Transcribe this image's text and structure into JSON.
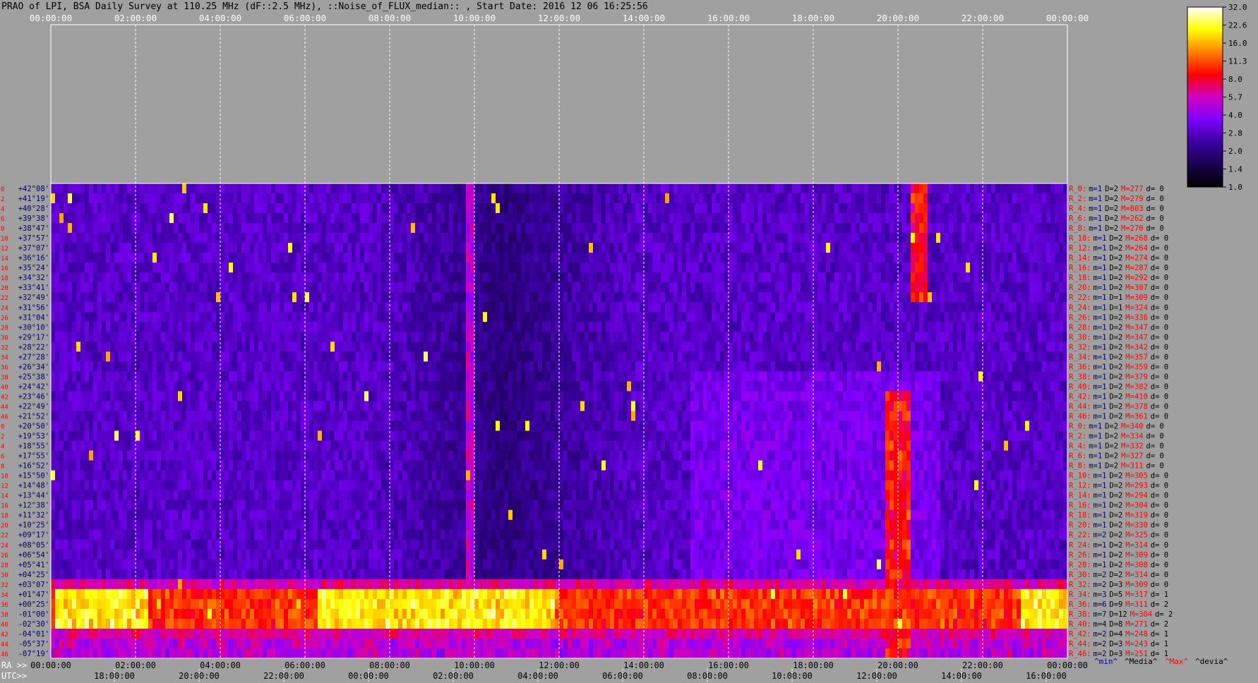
{
  "chart_data": {
    "type": "heatmap",
    "title": "PRAO of LPI, BSA Daily Survey at 110.25 MHz (dF::2.5 MHz), ::Noise_of_FLUX_median:: , Start Date: 2016 12 06 16:25:56",
    "x_top_ticks": [
      "00:00:00",
      "02:00:00",
      "04:00:00",
      "06:00:00",
      "08:00:00",
      "10:00:00",
      "12:00:00",
      "14:00:00",
      "16:00:00",
      "18:00:00",
      "20:00:00",
      "22:00:00",
      "00:00:00"
    ],
    "x_bottom_ra_prefix": "RA >>",
    "x_bottom_ra_ticks": [
      "00:00:00",
      "02:00:00",
      "04:00:00",
      "06:00:00",
      "08:00:00",
      "10:00:00",
      "12:00:00",
      "14:00:00",
      "16:00:00",
      "18:00:00",
      "20:00:00",
      "22:00:00",
      "00:00:00"
    ],
    "x_bottom_utc_prefix": "UTC>>",
    "x_bottom_utc_ticks": [
      "18:00:00",
      "20:00:00",
      "22:00:00",
      "00:00:00",
      "02:00:00",
      "04:00:00",
      "06:00:00",
      "08:00:00",
      "10:00:00",
      "12:00:00",
      "14:00:00",
      "16:00:00"
    ],
    "row_index_labels": [
      "0",
      "2",
      "4",
      "6",
      "8",
      "10",
      "12",
      "14",
      "16",
      "18",
      "20",
      "22",
      "24",
      "26",
      "28",
      "30",
      "32",
      "34",
      "36",
      "38",
      "40",
      "42",
      "44",
      "46",
      "0",
      "2",
      "4",
      "6",
      "8",
      "10",
      "12",
      "14",
      "16",
      "18",
      "20",
      "22",
      "24",
      "26",
      "28",
      "30",
      "32",
      "34",
      "36",
      "38",
      "40",
      "42",
      "44",
      "46"
    ],
    "declinations": [
      "+42°08'",
      "+41°19'",
      "+40°28'",
      "+39°38'",
      "+38°47'",
      "+37°57'",
      "+37°07'",
      "+36°16'",
      "+35°24'",
      "+34°32'",
      "+33°41'",
      "+32°49'",
      "+31°56'",
      "+31°04'",
      "+30°10'",
      "+29°17'",
      "+28°22'",
      "+27°28'",
      "+26°34'",
      "+25°38'",
      "+24°42'",
      "+23°46'",
      "+22°49'",
      "+21°52'",
      "+20°50'",
      "+19°53'",
      "+18°55'",
      "+17°55'",
      "+16°52'",
      "+15°50'",
      "+14°48'",
      "+13°44'",
      "+12°38'",
      "+11°32'",
      "+10°25'",
      "+09°17'",
      "+08°05'",
      "+06°54'",
      "+05°41'",
      "+04°25'",
      "+03°07'",
      "+01°47'",
      "+00°25'",
      "-01°00'",
      "-02°30'",
      "-04°01'",
      "-05°37'",
      "-07°19'"
    ],
    "right_stats": [
      {
        "r": "R_0:",
        "m": "m=1",
        "d": "D=2",
        "mx": "M=277",
        "dev": "d= 0"
      },
      {
        "r": "R_2:",
        "m": "m=1",
        "d": "D=2",
        "mx": "M=279",
        "dev": "d= 0"
      },
      {
        "r": "R_4:",
        "m": "m=1",
        "d": "D=2",
        "mx": "M=803",
        "dev": "d= 0"
      },
      {
        "r": "R_6:",
        "m": "m=1",
        "d": "D=2",
        "mx": "M=262",
        "dev": "d= 0"
      },
      {
        "r": "R_8:",
        "m": "m=1",
        "d": "D=2",
        "mx": "M=270",
        "dev": "d= 0"
      },
      {
        "r": "R_10:",
        "m": "m=1",
        "d": "D=2",
        "mx": "M=268",
        "dev": "d= 0"
      },
      {
        "r": "R_12:",
        "m": "m=1",
        "d": "D=2",
        "mx": "M=264",
        "dev": "d= 0"
      },
      {
        "r": "R_14:",
        "m": "m=1",
        "d": "D=2",
        "mx": "M=274",
        "dev": "d= 0"
      },
      {
        "r": "R_16:",
        "m": "m=1",
        "d": "D=2",
        "mx": "M=287",
        "dev": "d= 0"
      },
      {
        "r": "R_18:",
        "m": "m=1",
        "d": "D=2",
        "mx": "M=292",
        "dev": "d= 0"
      },
      {
        "r": "R_20:",
        "m": "m=1",
        "d": "D=2",
        "mx": "M=307",
        "dev": "d= 0"
      },
      {
        "r": "R_22:",
        "m": "m=1",
        "d": "D=1",
        "mx": "M=309",
        "dev": "d= 0"
      },
      {
        "r": "R_24:",
        "m": "m=1",
        "d": "D=1",
        "mx": "M=324",
        "dev": "d= 0"
      },
      {
        "r": "R_26:",
        "m": "m=1",
        "d": "D=2",
        "mx": "M=336",
        "dev": "d= 0"
      },
      {
        "r": "R_28:",
        "m": "m=1",
        "d": "D=2",
        "mx": "M=347",
        "dev": "d= 0"
      },
      {
        "r": "R_30:",
        "m": "m=1",
        "d": "D=2",
        "mx": "M=347",
        "dev": "d= 0"
      },
      {
        "r": "R_32:",
        "m": "m=1",
        "d": "D=2",
        "mx": "M=342",
        "dev": "d= 0"
      },
      {
        "r": "R_34:",
        "m": "m=1",
        "d": "D=2",
        "mx": "M=357",
        "dev": "d= 0"
      },
      {
        "r": "R_36:",
        "m": "m=1",
        "d": "D=2",
        "mx": "M=359",
        "dev": "d= 0"
      },
      {
        "r": "R_38:",
        "m": "m=1",
        "d": "D=2",
        "mx": "M=379",
        "dev": "d= 0"
      },
      {
        "r": "R_40:",
        "m": "m=1",
        "d": "D=2",
        "mx": "M=382",
        "dev": "d= 0"
      },
      {
        "r": "R_42:",
        "m": "m=1",
        "d": "D=2",
        "mx": "M=410",
        "dev": "d= 0"
      },
      {
        "r": "R_44:",
        "m": "m=1",
        "d": "D=2",
        "mx": "M=378",
        "dev": "d= 0"
      },
      {
        "r": "R_46:",
        "m": "m=1",
        "d": "D=2",
        "mx": "M=361",
        "dev": "d= 0"
      },
      {
        "r": "R_0:",
        "m": "m=1",
        "d": "D=2",
        "mx": "M=340",
        "dev": "d= 0"
      },
      {
        "r": "R_2:",
        "m": "m=1",
        "d": "D=2",
        "mx": "M=334",
        "dev": "d= 0"
      },
      {
        "r": "R_4:",
        "m": "m=1",
        "d": "D=2",
        "mx": "M=332",
        "dev": "d= 0"
      },
      {
        "r": "R_6:",
        "m": "m=1",
        "d": "D=2",
        "mx": "M=327",
        "dev": "d= 0"
      },
      {
        "r": "R_8:",
        "m": "m=1",
        "d": "D=2",
        "mx": "M=311",
        "dev": "d= 0"
      },
      {
        "r": "R_10:",
        "m": "m=1",
        "d": "D=2",
        "mx": "M=305",
        "dev": "d= 0"
      },
      {
        "r": "R_12:",
        "m": "m=1",
        "d": "D=2",
        "mx": "M=293",
        "dev": "d= 0"
      },
      {
        "r": "R_14:",
        "m": "m=1",
        "d": "D=2",
        "mx": "M=294",
        "dev": "d= 0"
      },
      {
        "r": "R_16:",
        "m": "m=1",
        "d": "D=2",
        "mx": "M=304",
        "dev": "d= 0"
      },
      {
        "r": "R_18:",
        "m": "m=1",
        "d": "D=2",
        "mx": "M=319",
        "dev": "d= 0"
      },
      {
        "r": "R_20:",
        "m": "m=1",
        "d": "D=2",
        "mx": "M=330",
        "dev": "d= 0"
      },
      {
        "r": "R_22:",
        "m": "m=2",
        "d": "D=2",
        "mx": "M=325",
        "dev": "d= 0"
      },
      {
        "r": "R_24:",
        "m": "m=1",
        "d": "D=2",
        "mx": "M=314",
        "dev": "d= 0"
      },
      {
        "r": "R_26:",
        "m": "m=1",
        "d": "D=2",
        "mx": "M=309",
        "dev": "d= 0"
      },
      {
        "r": "R_28:",
        "m": "m=1",
        "d": "D=2",
        "mx": "M=308",
        "dev": "d= 0"
      },
      {
        "r": "R_30:",
        "m": "m=2",
        "d": "D=2",
        "mx": "M=314",
        "dev": "d= 0"
      },
      {
        "r": "R_32:",
        "m": "m=2",
        "d": "D=3",
        "mx": "M=309",
        "dev": "d= 0"
      },
      {
        "r": "R_34:",
        "m": "m=3",
        "d": "D=5",
        "mx": "M=317",
        "dev": "d= 1"
      },
      {
        "r": "R_36:",
        "m": "m=6",
        "d": "D=9",
        "mx": "M=311",
        "dev": "d= 2"
      },
      {
        "r": "R_38:",
        "m": "m=7",
        "d": "D=12",
        "mx": "M=304",
        "dev": "d= 2"
      },
      {
        "r": "R_40:",
        "m": "m=4",
        "d": "D=8",
        "mx": "M=271",
        "dev": "d= 2"
      },
      {
        "r": "R_42:",
        "m": "m=2",
        "d": "D=4",
        "mx": "M=248",
        "dev": "d= 1"
      },
      {
        "r": "R_44:",
        "m": "m=2",
        "d": "D=3",
        "mx": "M=243",
        "dev": "d= 1"
      },
      {
        "r": "R_46:",
        "m": "m=2",
        "d": "D=3",
        "mx": "M=251",
        "dev": "d= 1"
      }
    ],
    "stats_legend": [
      {
        "label": "^min^",
        "color": "#0000aa"
      },
      {
        "label": "^Media^",
        "color": "#000000"
      },
      {
        "label": "^Max^",
        "color": "#ff0000"
      },
      {
        "label": "^devia^",
        "color": "#000000"
      }
    ],
    "colorbar_ticks": [
      "32.0",
      "22.6",
      "16.0",
      "11.3",
      "8.0",
      "5.7",
      "4.0",
      "2.8",
      "2.0",
      "1.4",
      "1.0"
    ],
    "colorbar_range": [
      1.0,
      32.0
    ],
    "colorbar_scale": "log",
    "colormap_stops": [
      "#000000",
      "#1a0050",
      "#3a00a0",
      "#8000ff",
      "#d000c0",
      "#ff0000",
      "#ff8000",
      "#ffff00",
      "#ffffff"
    ],
    "band_bright_rows": [
      "+01°47'",
      "+00°25'",
      "-01°00'",
      "-02°30'"
    ],
    "time_range_hours": [
      0,
      24
    ]
  }
}
